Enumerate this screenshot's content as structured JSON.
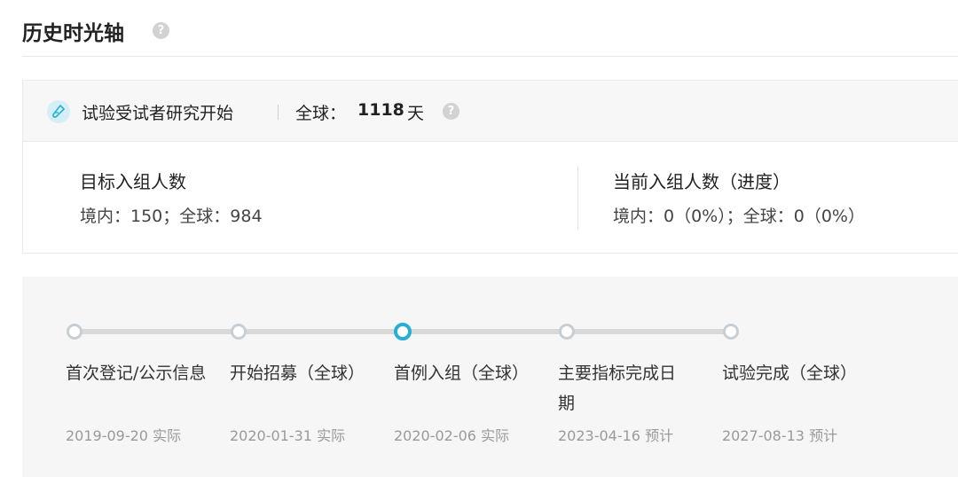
{
  "header": {
    "title": "历史时光轴",
    "help_icon": "question-circle-icon"
  },
  "study": {
    "label": "试验受试者研究开始",
    "global_prefix": "全球：",
    "global_days": "1118",
    "days_unit": "天",
    "icon": "test-tube-icon"
  },
  "enrollment": {
    "target_title": "目标入组人数",
    "target_value": "境内：150；全球：984",
    "current_title": "当前入组人数（进度）",
    "current_value": "境内：0（0%）；全球：0（0%）"
  },
  "timeline": {
    "milestones": [
      {
        "label": "首次登记/公示信息",
        "date": "2019-09-20 实际",
        "active": false
      },
      {
        "label": "开始招募（全球）",
        "date": "2020-01-31 实际",
        "active": false
      },
      {
        "label": "首例入组（全球）",
        "date": "2020-02-06 实际",
        "active": true
      },
      {
        "label": "主要指标完成日期",
        "date": "2023-04-16 预计",
        "active": false
      },
      {
        "label": "试验完成（全球）",
        "date": "2027-08-13 预计",
        "active": false
      }
    ]
  },
  "colors": {
    "accent": "#29aed4",
    "track": "#d9d9d9",
    "dot_border": "#c8ced2"
  }
}
